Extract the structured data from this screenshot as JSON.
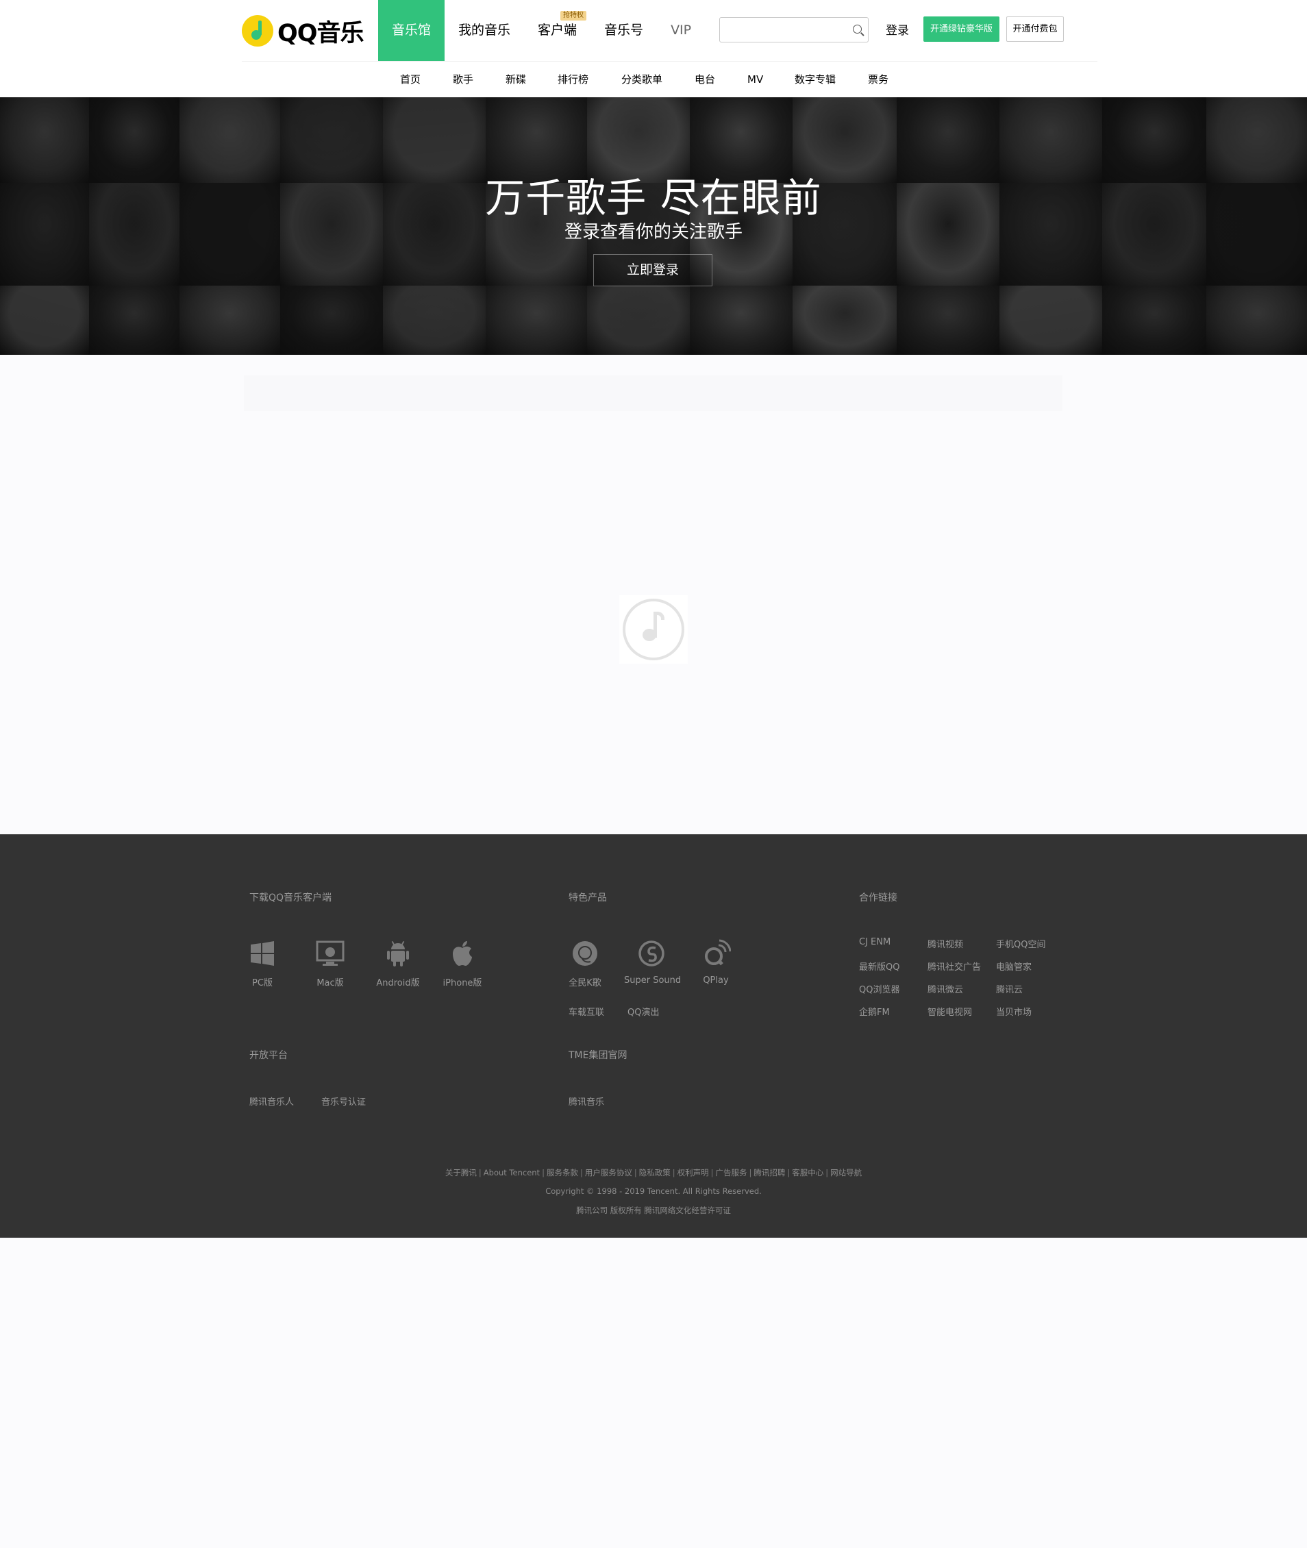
{
  "header": {
    "logo_text": "QQ音乐",
    "nav": [
      {
        "label": "音乐馆",
        "active": true
      },
      {
        "label": "我的音乐"
      },
      {
        "label": "客户端",
        "badge": "抢特权"
      },
      {
        "label": "音乐号"
      },
      {
        "label": "VIP"
      }
    ],
    "search_placeholder": "",
    "login_label": "登录",
    "green_button_label": "开通绿钻豪华版",
    "outline_button_label": "开通付费包",
    "accent_color": "#31c27c"
  },
  "subnav": [
    "首页",
    "歌手",
    "新碟",
    "排行榜",
    "分类歌单",
    "电台",
    "MV",
    "数字专辑",
    "票务"
  ],
  "hero": {
    "title": "万千歌手 尽在眼前",
    "subtitle": "登录查看你的关注歌手",
    "button_label": "立即登录"
  },
  "footer": {
    "download": {
      "heading": "下载QQ音乐客户端",
      "items": [
        {
          "label": "PC版",
          "icon": "windows-icon"
        },
        {
          "label": "Mac版",
          "icon": "mac-icon"
        },
        {
          "label": "Android版",
          "icon": "android-icon"
        },
        {
          "label": "iPhone版",
          "icon": "apple-icon"
        }
      ]
    },
    "products": {
      "heading": "特色产品",
      "items": [
        {
          "label": "全民K歌",
          "icon": "karaoke-icon"
        },
        {
          "label": "Super Sound",
          "icon": "super-sound-icon"
        },
        {
          "label": "QPlay",
          "icon": "qplay-icon"
        }
      ],
      "links": [
        "车载互联",
        "QQ演出"
      ]
    },
    "partners": {
      "heading": "合作链接",
      "links": [
        "CJ ENM",
        "腾讯视频",
        "手机QQ空间",
        "最新版QQ",
        "腾讯社交广告",
        "电脑管家",
        "QQ浏览器",
        "腾讯微云",
        "腾讯云",
        "企鹅FM",
        "智能电视网",
        "当贝市场"
      ]
    },
    "open_platform": {
      "heading": "开放平台",
      "links": [
        "腾讯音乐人",
        "音乐号认证"
      ]
    },
    "tme": {
      "heading": "TME集团官网",
      "links": [
        "腾讯音乐"
      ]
    },
    "bottom_links": [
      "关于腾讯",
      "About Tencent",
      "服务条款",
      "用户服务协议",
      "隐私政策",
      "权利声明",
      "广告服务",
      "腾讯招聘",
      "客服中心",
      "网站导航"
    ],
    "copyright": "Copyright © 1998 - 2019 Tencent. All Rights Reserved.",
    "license": "腾讯公司 版权所有 腾讯网络文化经营许可证"
  }
}
